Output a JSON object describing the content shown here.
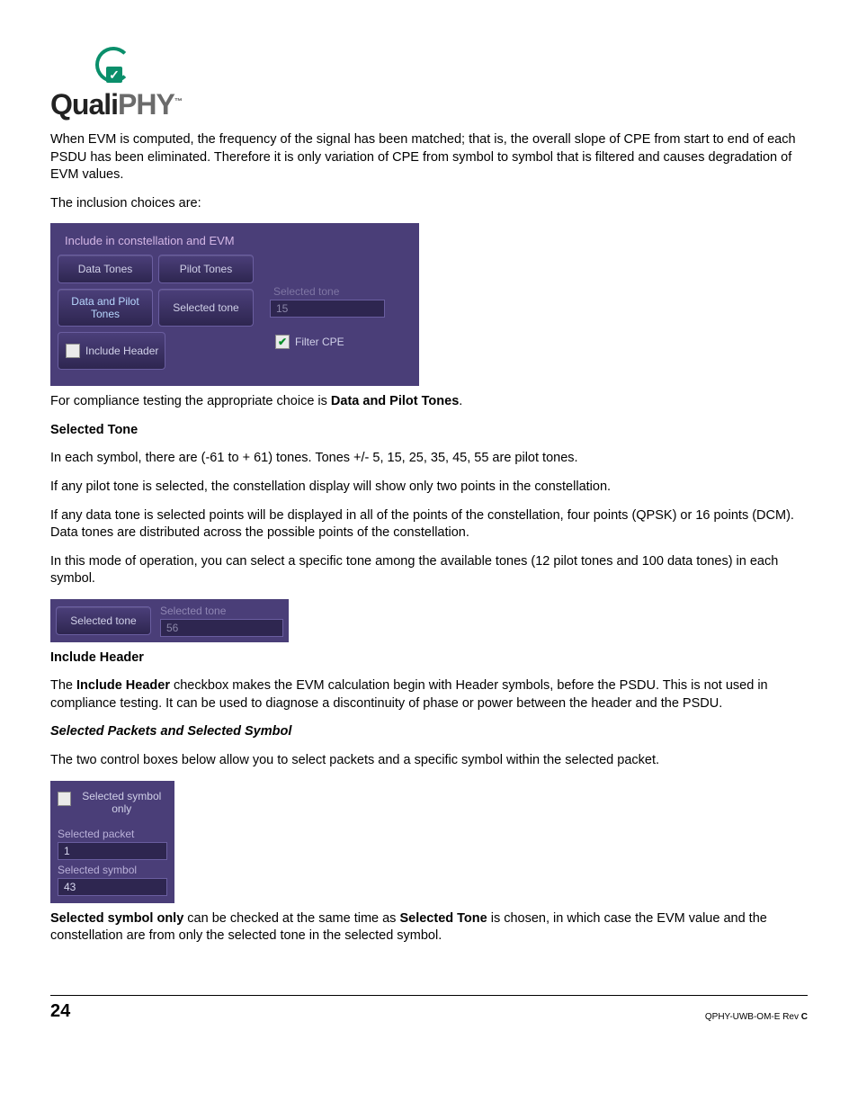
{
  "logo": {
    "text_quali": "Quali",
    "text_phy": "PHY",
    "tm": "™"
  },
  "para1": "When EVM is computed, the frequency of the signal has been matched; that is, the overall slope of CPE from start to end of each PSDU has been eliminated. Therefore it is only variation of CPE from symbol to symbol that is filtered and causes degradation of EVM values.",
  "para2": "The inclusion choices are:",
  "panel1": {
    "title": "Include in constellation and EVM",
    "btn_data_tones": "Data Tones",
    "btn_pilot_tones": "Pilot Tones",
    "btn_data_pilot": "Data and Pilot Tones",
    "btn_selected_tone": "Selected tone",
    "chk_include_header": "Include Header",
    "lbl_selected_tone": "Selected tone",
    "val_selected_tone": "15",
    "chk_filter_cpe": "Filter CPE"
  },
  "para3a": "For compliance testing the appropriate choice is ",
  "para3b": "Data and Pilot Tones",
  "para3c": ".",
  "h_selected_tone": "Selected Tone",
  "para4": "In each symbol, there are (-61 to + 61) tones. Tones +/- 5, 15, 25, 35, 45, 55 are pilot tones.",
  "para5": "If any pilot tone is selected, the constellation display will show only two points in the constellation.",
  "para6": "If any data tone is selected points will be displayed in all of the points of the constellation, four points (QPSK) or 16 points (DCM). Data tones are distributed across the possible points of the constellation.",
  "para7": "In this mode of operation, you can select a specific tone among the available tones (12 pilot tones and 100 data tones) in each symbol.",
  "panel2": {
    "btn": "Selected tone",
    "lbl": "Selected tone",
    "val": "56"
  },
  "h_include_header": "Include Header",
  "para8a": "The ",
  "para8b": "Include Header",
  "para8c": " checkbox makes the EVM calculation begin with Header symbols, before the PSDU. This is not used in compliance testing. It can be used to diagnose a discontinuity of phase or power between the header and the PSDU.",
  "h_selected_packets": "Selected Packets and Selected Symbol",
  "para9": "The two control boxes below allow you to select packets and a specific symbol within the selected packet.",
  "panel3": {
    "chk": "Selected symbol only",
    "lbl_packet": "Selected packet",
    "val_packet": "1",
    "lbl_symbol": "Selected symbol",
    "val_symbol": "43"
  },
  "para10a": "Selected symbol only",
  "para10b": " can be checked at the same time as ",
  "para10c": "Selected Tone",
  "para10d": " is chosen, in which case the EVM value and the constellation are from only the selected tone in the selected symbol.",
  "footer": {
    "page": "24",
    "rev_a": "QPHY-UWB-OM-E Rev ",
    "rev_b": "C"
  }
}
